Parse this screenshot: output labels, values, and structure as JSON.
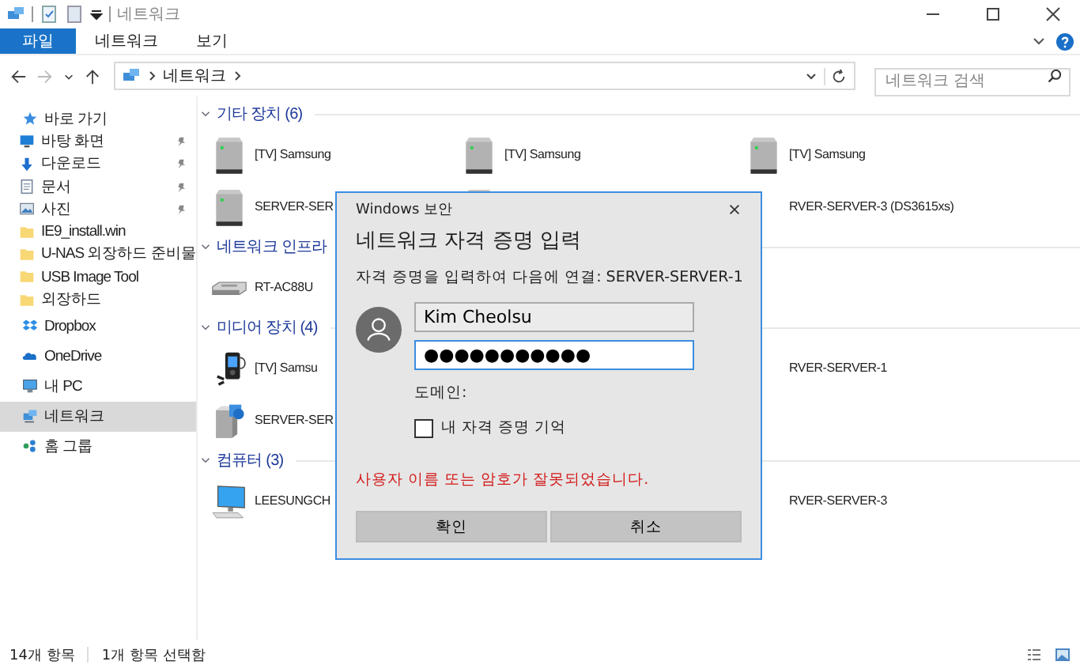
{
  "window": {
    "title": "네트워크"
  },
  "ribbon": {
    "tabs": [
      {
        "label": "파일",
        "selected": true
      },
      {
        "label": "네트워크",
        "selected": false
      },
      {
        "label": "보기",
        "selected": false
      }
    ]
  },
  "address": {
    "path": "네트워크",
    "search_placeholder": "네트워크 검색"
  },
  "sidebar": {
    "items": [
      {
        "label": "바로 가기",
        "kind": "star",
        "selected": false,
        "children": [
          {
            "label": "바탕 화면",
            "kind": "desktop",
            "pinned": true,
            "selected": false
          },
          {
            "label": "다운로드",
            "kind": "download",
            "pinned": true,
            "selected": false
          },
          {
            "label": "문서",
            "kind": "document",
            "pinned": true,
            "selected": false
          },
          {
            "label": "사진",
            "kind": "image",
            "pinned": true,
            "selected": false
          },
          {
            "label": "IE9_install.win",
            "kind": "folder",
            "pinned": false,
            "selected": false
          },
          {
            "label": "U-NAS 외장하드 준비물",
            "kind": "folder",
            "pinned": false,
            "selected": false
          },
          {
            "label": "USB Image Tool",
            "kind": "folder",
            "pinned": false,
            "selected": false
          },
          {
            "label": "외장하드",
            "kind": "folder",
            "pinned": false,
            "selected": false
          }
        ]
      },
      {
        "label": "Dropbox",
        "kind": "dropbox",
        "selected": false
      },
      {
        "label": "OneDrive",
        "kind": "cloud",
        "selected": false
      },
      {
        "label": "내 PC",
        "kind": "pc",
        "selected": false
      },
      {
        "label": "네트워크",
        "kind": "network",
        "selected": true
      },
      {
        "label": "홈 그룹",
        "kind": "homegroup",
        "selected": false
      }
    ]
  },
  "sections": [
    {
      "title": "기타 장치 (6)",
      "rows": [
        [
          {
            "label": "[TV] Samsung",
            "kind": "server"
          },
          {
            "label": "[TV] Samsung",
            "kind": "server"
          },
          {
            "label": "[TV] Samsung",
            "kind": "server"
          }
        ],
        [
          {
            "label": "SERVER-SER",
            "kind": "server"
          },
          {
            "kind": "server"
          },
          {
            "label": "RVER-SERVER-3 (DS3615xs)"
          }
        ]
      ]
    },
    {
      "title": "네트워크 인프라",
      "rows": [
        [
          {
            "label": "RT-AC88U",
            "kind": "router"
          }
        ]
      ]
    },
    {
      "title": "미디어 장치 (4)",
      "rows": [
        [
          {
            "label": "[TV] Samsu",
            "kind": "player"
          },
          null,
          {
            "label": "RVER-SERVER-1"
          }
        ],
        [
          {
            "label": "SERVER-SER",
            "kind": "mediaserver"
          }
        ]
      ]
    },
    {
      "title": "컴퓨터 (3)",
      "rows": [
        [
          {
            "label": "LEESUNGCH",
            "kind": "computer"
          },
          null,
          {
            "label": "RVER-SERVER-3"
          }
        ]
      ]
    }
  ],
  "status_bar": {
    "count": "14개 항목",
    "selection": "1개 항목 선택함"
  },
  "dialog": {
    "caption": "Windows 보안",
    "heading": "네트워크 자격 증명 입력",
    "prompt": "자격 증명을 입력하여 다음에 연결: SERVER-SERVER-1",
    "username": "Kim Cheolsu",
    "password": "●●●●●●●●●●●",
    "domain_label": "도메인:",
    "remember": {
      "label": "내 자격 증명 기억",
      "checked": false
    },
    "error": "사용자 이름 또는 암호가 잘못되었습니다.",
    "buttons": [
      "확인",
      "취소"
    ]
  }
}
